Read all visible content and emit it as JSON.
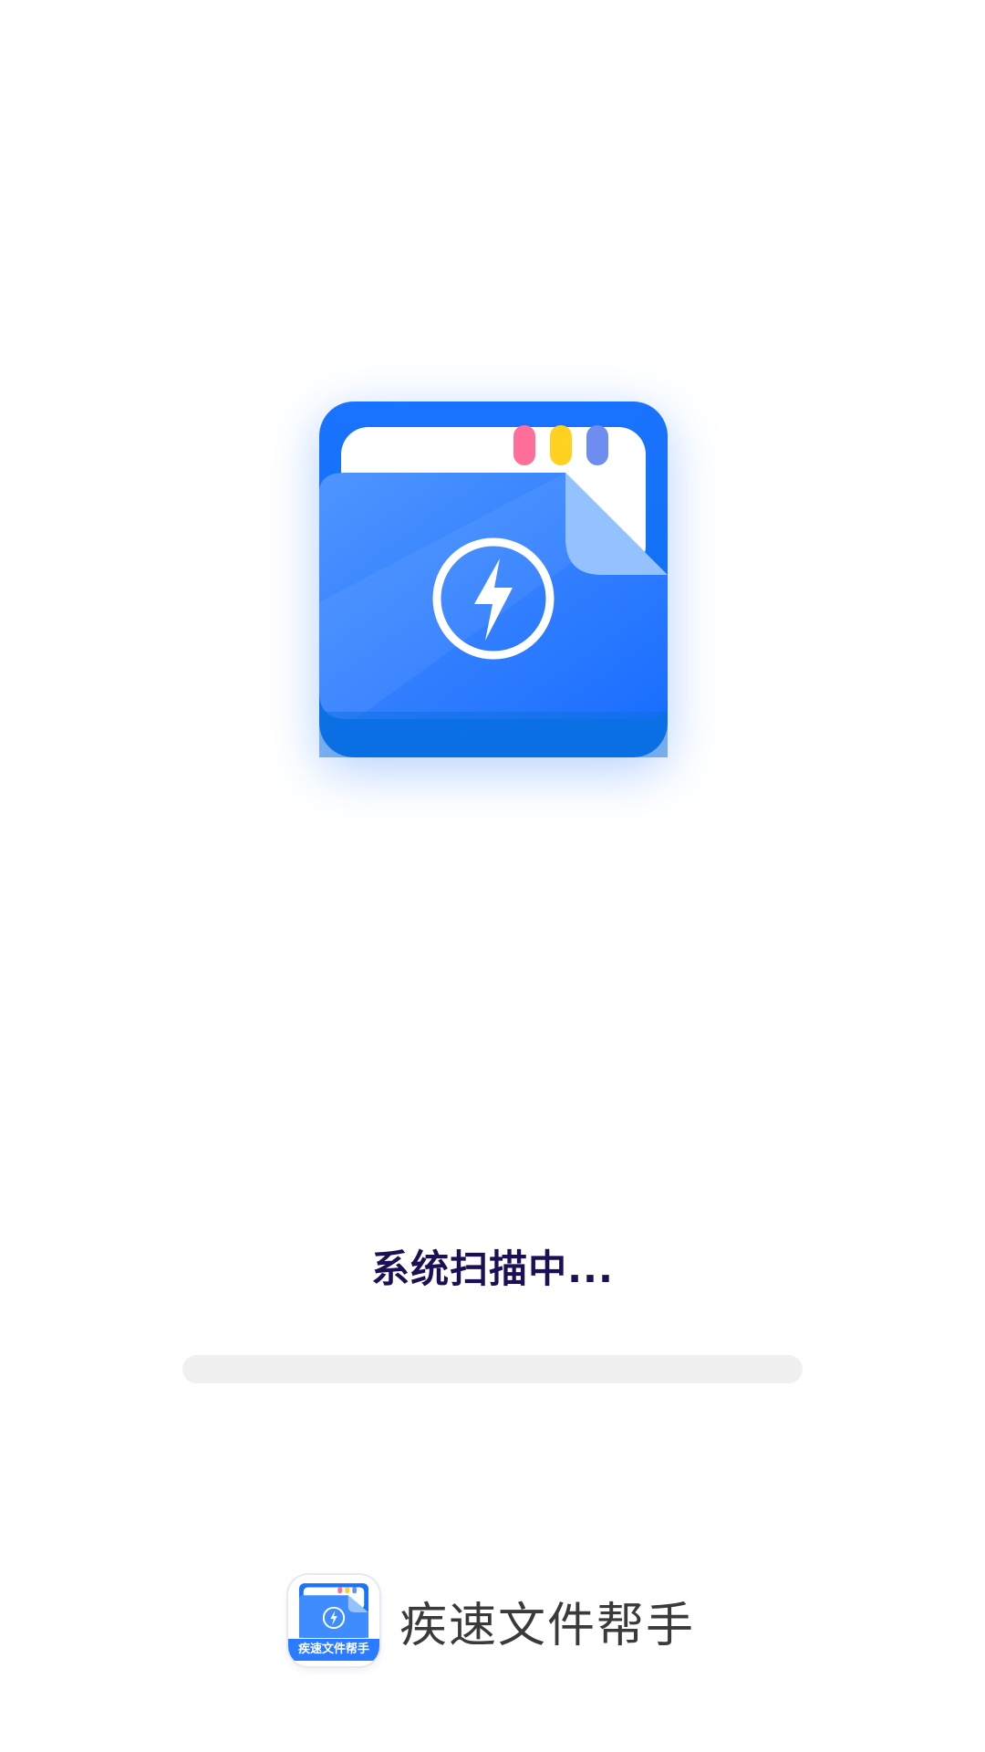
{
  "splash": {
    "status_text": "系统扫描中...",
    "progress": 0
  },
  "brand": {
    "icon_label": "疾速文件帮手",
    "app_name": "疾速文件帮手",
    "icon": "folder-lightning-icon"
  },
  "colors": {
    "primary_blue": "#1a73ff",
    "status_text": "#1d0f55",
    "tab_pink": "#ff6f9a",
    "tab_yellow": "#ffd21f",
    "tab_purple": "#6d8ef0"
  }
}
